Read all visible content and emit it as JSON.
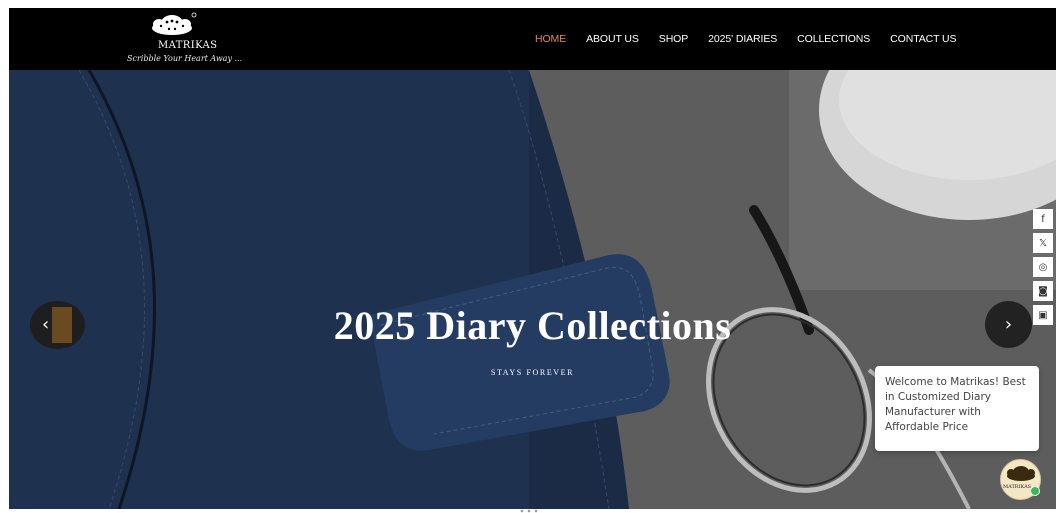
{
  "brand": {
    "name": "MATRIKAS",
    "tagline": "Scribble Your Heart Away ..."
  },
  "nav": {
    "items": [
      {
        "label": "HOME",
        "active": true
      },
      {
        "label": "ABOUT US",
        "active": false
      },
      {
        "label": "SHOP",
        "active": false
      },
      {
        "label": "2025' DIARIES",
        "active": false
      },
      {
        "label": "COLLECTIONS",
        "active": false
      },
      {
        "label": "CONTACT US",
        "active": false
      }
    ],
    "active_color": "#e88a3a"
  },
  "hero": {
    "title": "2025 Diary Collections",
    "subtitle": "STAYS FOREVER",
    "prev_icon": "chevron-left-icon",
    "next_icon": "chevron-right-icon"
  },
  "social": {
    "icons": [
      "facebook-icon",
      "x-icon",
      "pinterest-icon",
      "instagram-icon",
      "youtube-icon"
    ],
    "glyphs": [
      "f",
      "𝕏",
      "◎",
      "◙",
      "▣"
    ]
  },
  "chat": {
    "message": "Welcome to Matrikas! Best in Customized Diary Manufacturer with Affordable Price",
    "avatar_label": "MATRIKAS",
    "status_color": "#2fbf4f"
  },
  "colors": {
    "header_bg": "#000000",
    "diary_blue": "#23385a"
  }
}
